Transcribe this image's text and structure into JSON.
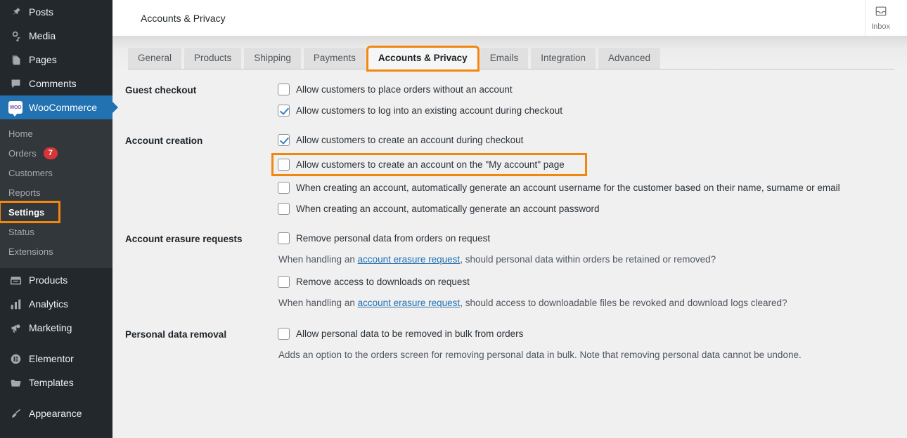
{
  "sidebar": {
    "items": [
      {
        "label": "Posts",
        "icon": "pin-icon",
        "name": "sidebar-item-posts"
      },
      {
        "label": "Media",
        "icon": "media-icon",
        "name": "sidebar-item-media"
      },
      {
        "label": "Pages",
        "icon": "pages-icon",
        "name": "sidebar-item-pages"
      },
      {
        "label": "Comments",
        "icon": "comment-icon",
        "name": "sidebar-item-comments"
      },
      {
        "label": "WooCommerce",
        "icon": "woocommerce-icon",
        "name": "sidebar-item-woocommerce",
        "active": true
      }
    ],
    "submenu": [
      {
        "label": "Home",
        "name": "submenu-item-home"
      },
      {
        "label": "Orders",
        "badge": "7",
        "name": "submenu-item-orders"
      },
      {
        "label": "Customers",
        "name": "submenu-item-customers"
      },
      {
        "label": "Reports",
        "name": "submenu-item-reports"
      },
      {
        "label": "Settings",
        "name": "submenu-item-settings",
        "current": true,
        "highlight": true
      },
      {
        "label": "Status",
        "name": "submenu-item-status"
      },
      {
        "label": "Extensions",
        "name": "submenu-item-extensions"
      }
    ],
    "items_lower": [
      {
        "label": "Products",
        "icon": "products-icon",
        "name": "sidebar-item-products"
      },
      {
        "label": "Analytics",
        "icon": "analytics-icon",
        "name": "sidebar-item-analytics"
      },
      {
        "label": "Marketing",
        "icon": "megaphone-icon",
        "name": "sidebar-item-marketing"
      },
      {
        "label": "Elementor",
        "icon": "elementor-icon",
        "name": "sidebar-item-elementor",
        "spacer_before": true
      },
      {
        "label": "Templates",
        "icon": "folder-icon",
        "name": "sidebar-item-templates"
      },
      {
        "label": "Appearance",
        "icon": "brush-icon",
        "name": "sidebar-item-appearance",
        "spacer_before": true
      }
    ]
  },
  "topbar": {
    "title": "Accounts & Privacy",
    "inbox_label": "Inbox"
  },
  "tabs": [
    {
      "label": "General",
      "name": "tab-general"
    },
    {
      "label": "Products",
      "name": "tab-products"
    },
    {
      "label": "Shipping",
      "name": "tab-shipping"
    },
    {
      "label": "Payments",
      "name": "tab-payments"
    },
    {
      "label": "Accounts & Privacy",
      "name": "tab-accounts-privacy",
      "active": true,
      "highlight": true
    },
    {
      "label": "Emails",
      "name": "tab-emails"
    },
    {
      "label": "Integration",
      "name": "tab-integration"
    },
    {
      "label": "Advanced",
      "name": "tab-advanced"
    }
  ],
  "settings": {
    "guest_checkout": {
      "title": "Guest checkout",
      "options": [
        {
          "label": "Allow customers to place orders without an account",
          "checked": false
        },
        {
          "label": "Allow customers to log into an existing account during checkout",
          "checked": true
        }
      ]
    },
    "account_creation": {
      "title": "Account creation",
      "options": [
        {
          "label": "Allow customers to create an account during checkout",
          "checked": true
        },
        {
          "label": "Allow customers to create an account on the \"My account\" page",
          "checked": false,
          "highlight": true
        },
        {
          "label": "When creating an account, automatically generate an account username for the customer based on their name, surname or email",
          "checked": false
        },
        {
          "label": "When creating an account, automatically generate an account password",
          "checked": false
        }
      ]
    },
    "account_erasure": {
      "title": "Account erasure requests",
      "option1": {
        "label": "Remove personal data from orders on request",
        "checked": false
      },
      "desc1_before": "When handling an ",
      "desc1_link": "account erasure request",
      "desc1_after": ", should personal data within orders be retained or removed?",
      "option2": {
        "label": "Remove access to downloads on request",
        "checked": false
      },
      "desc2_before": "When handling an ",
      "desc2_link": "account erasure request",
      "desc2_after": ", should access to downloadable files be revoked and download logs cleared?"
    },
    "personal_data_removal": {
      "title": "Personal data removal",
      "option": {
        "label": "Allow personal data to be removed in bulk from orders",
        "checked": false
      },
      "desc": "Adds an option to the orders screen for removing personal data in bulk. Note that removing personal data cannot be undone."
    }
  },
  "colors": {
    "highlight": "#f2870d",
    "accent": "#2271b1",
    "badge": "#d63638",
    "sidebar_bg": "#23282d",
    "submenu_bg": "#32373c"
  }
}
